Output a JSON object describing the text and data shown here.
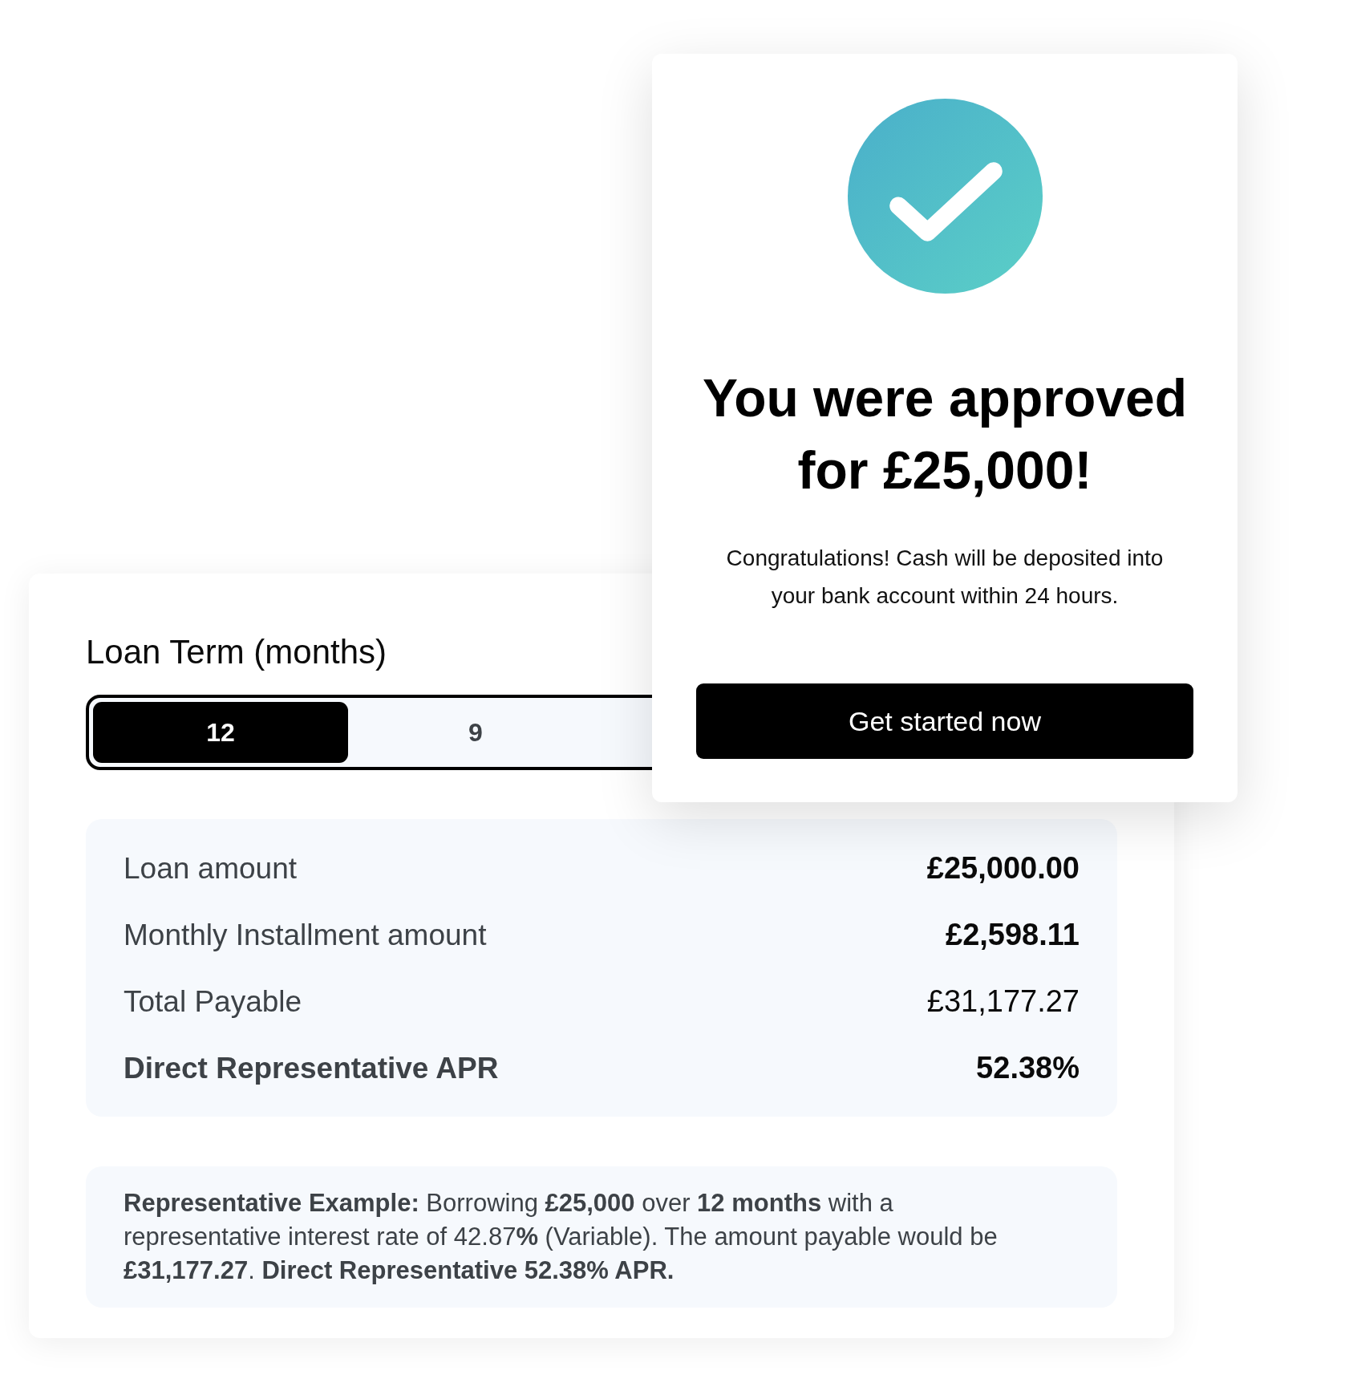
{
  "loan_term": {
    "label": "Loan Term (months)",
    "options": [
      {
        "label": "12",
        "selected": true
      },
      {
        "label": "9",
        "selected": false
      }
    ]
  },
  "summary": {
    "rows": [
      {
        "label": "Loan amount",
        "value": "£25,000.00",
        "label_bold": false,
        "value_bold": true
      },
      {
        "label": "Monthly Installment amount",
        "value": "£2,598.11",
        "label_bold": false,
        "value_bold": true
      },
      {
        "label": "Total Payable",
        "value": "£31,177.27",
        "label_bold": false,
        "value_bold": false
      },
      {
        "label": "Direct Representative APR",
        "value": "52.38%",
        "label_bold": true,
        "value_bold": true
      }
    ]
  },
  "example": {
    "text": "**Representative Example:** Borrowing **£25,000** over **12 months** with a representative interest rate of 42.87**%** (Variable). The amount payable would be **£31,177.27**. **Direct Representative 52.38% APR.**"
  },
  "approval": {
    "title": "You were approved for £25,000!",
    "message": "Congratulations! Cash will be deposited into your bank account within 24 hours.",
    "button": "Get started now"
  }
}
